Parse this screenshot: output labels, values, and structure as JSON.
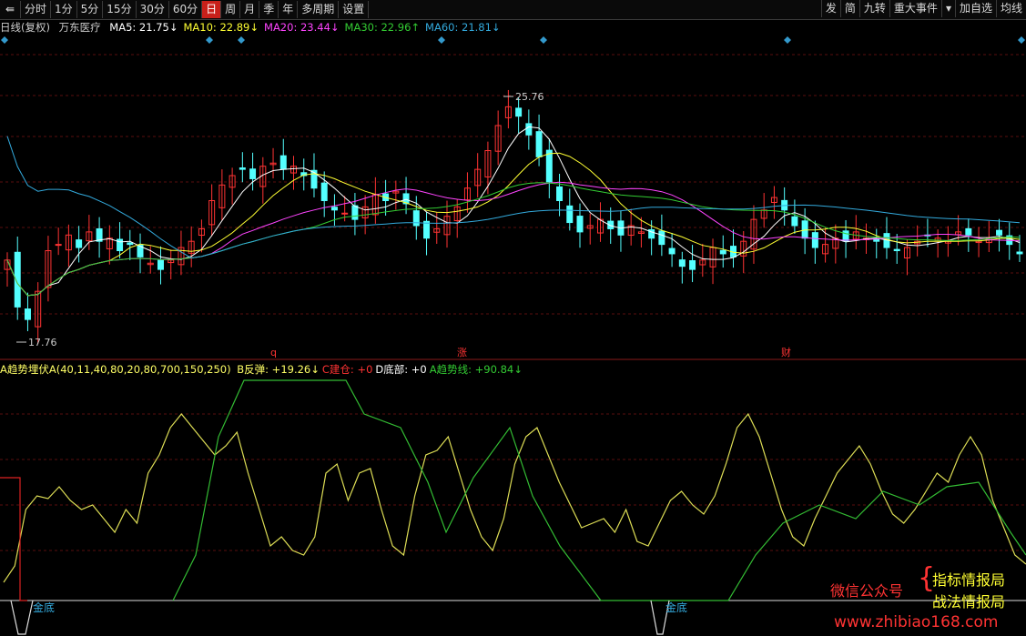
{
  "toolbar": {
    "items": [
      "分时",
      "1分",
      "5分",
      "15分",
      "30分",
      "60分",
      "日",
      "周",
      "月",
      "季",
      "年",
      "多周期",
      "设置"
    ],
    "active": "日",
    "right": [
      "发",
      "简",
      "九转",
      "重大事件",
      "加自选",
      "均线"
    ]
  },
  "header": {
    "period": "日线(复权)",
    "stock": "万东医疗",
    "ma": [
      {
        "label": "MA5: 21.75↓",
        "color": "#ffffff"
      },
      {
        "label": "MA10: 22.89↓",
        "color": "#ffff33"
      },
      {
        "label": "MA20: 23.44↓",
        "color": "#ff44ff"
      },
      {
        "label": "MA30: 22.96↑",
        "color": "#33cc33"
      },
      {
        "label": "MA60: 21.81↓",
        "color": "#33aadd"
      }
    ]
  },
  "price_chart": {
    "high_label": "25.76",
    "low_label": "17.76",
    "event_marks": [
      {
        "text": "q",
        "color": "#ff3333"
      },
      {
        "text": "涨",
        "color": "#ff3333"
      },
      {
        "text": "财",
        "color": "#ff3333"
      }
    ]
  },
  "indicator": {
    "name": "A趋势埋伏A(40,11,40,80,20,80,700,150,250)",
    "items": [
      {
        "label": "B反弹: +19.26↓",
        "color": "#ffff66"
      },
      {
        "label": "C建仓: +0",
        "color": "#ff3333"
      },
      {
        "label": "D底部: +0",
        "color": "#ffffff"
      },
      {
        "label": "A趋势线: +90.84↓",
        "color": "#33cc33"
      }
    ],
    "bottom_labels": [
      "金底",
      "金底"
    ]
  },
  "watermark": {
    "wechat": "微信公众号",
    "name1": "指标情报局",
    "name2": "战法情报局",
    "url": "www.zhibiao168.com"
  },
  "colors": {
    "up": "#ff3333",
    "down": "#54ffff",
    "ma5": "#ffffff",
    "ma10": "#ffff33",
    "ma20": "#ff44ff",
    "ma30": "#33cc33",
    "ma60": "#33aadd"
  }
}
